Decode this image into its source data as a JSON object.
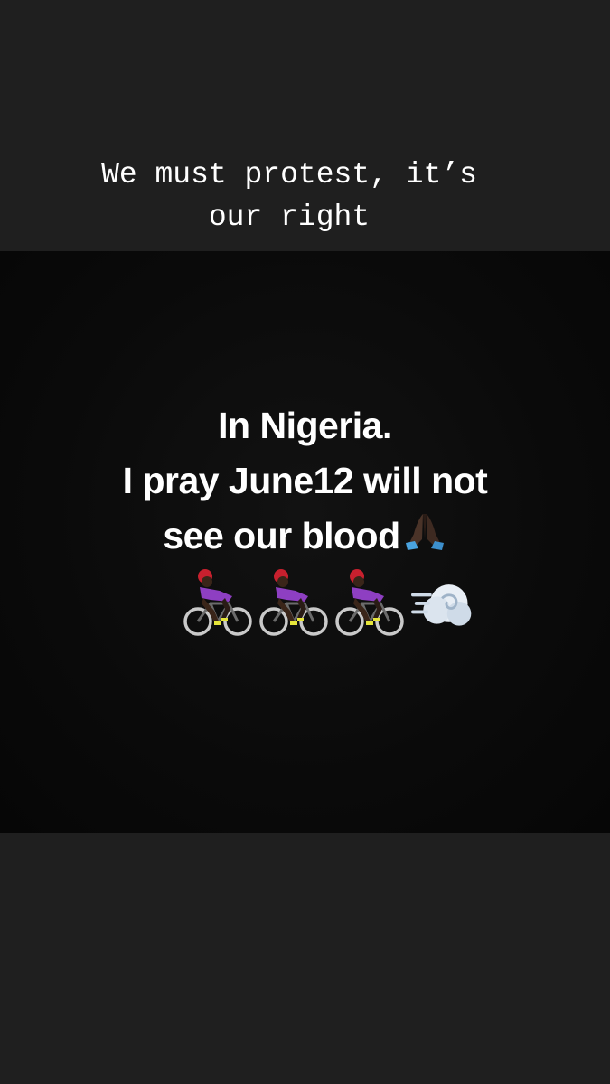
{
  "story": {
    "caption_line1": "We must protest, it’s",
    "caption_line2": "our right"
  },
  "post": {
    "line1": "In Nigeria.",
    "line2": "I pray June12 will not",
    "line3": "see our blood",
    "emojis": [
      "folded-hands-icon",
      "bicyclist-icon",
      "bicyclist-icon",
      "bicyclist-icon",
      "dash-icon"
    ],
    "colors": {
      "background": "#1f1f1f",
      "image_background": "#0a0a0a",
      "text": "#ffffff"
    }
  }
}
